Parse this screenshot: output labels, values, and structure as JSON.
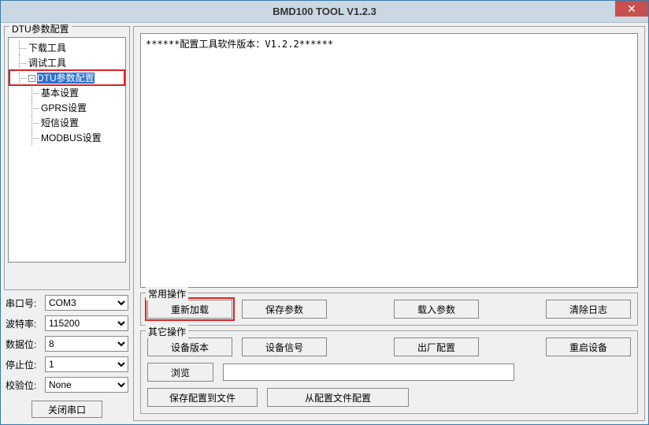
{
  "window": {
    "title": "BMD100 TOOL V1.2.3"
  },
  "tree": {
    "group_label": "DTU参数配置",
    "items": [
      {
        "label": "下载工具",
        "level": 1
      },
      {
        "label": "调试工具",
        "level": 1
      },
      {
        "label": "DTU参数配置",
        "level": 1,
        "expandable": true,
        "selected": true,
        "highlight": true
      },
      {
        "label": "基本设置",
        "level": 2
      },
      {
        "label": "GPRS设置",
        "level": 2
      },
      {
        "label": "短信设置",
        "level": 2
      },
      {
        "label": "MODBUS设置",
        "level": 2
      }
    ]
  },
  "serial": {
    "port_label": "串口号:",
    "port_value": "COM3",
    "baud_label": "波特率:",
    "baud_value": "115200",
    "data_label": "数据位:",
    "data_value": "8",
    "stop_label": "停止位:",
    "stop_value": "1",
    "parity_label": "校验位:",
    "parity_value": "None",
    "close_btn": "关闭串口"
  },
  "log": {
    "text": "******配置工具软件版本：V1.2.2******"
  },
  "common_ops": {
    "label": "常用操作",
    "reload": "重新加载",
    "save": "保存参数",
    "load": "载入参数",
    "clear": "清除日志"
  },
  "other_ops": {
    "label": "其它操作",
    "version": "设备版本",
    "signal": "设备信号",
    "factory": "出厂配置",
    "restart": "重启设备",
    "browse": "浏览",
    "save_file": "保存配置到文件",
    "load_file": "从配置文件配置"
  }
}
